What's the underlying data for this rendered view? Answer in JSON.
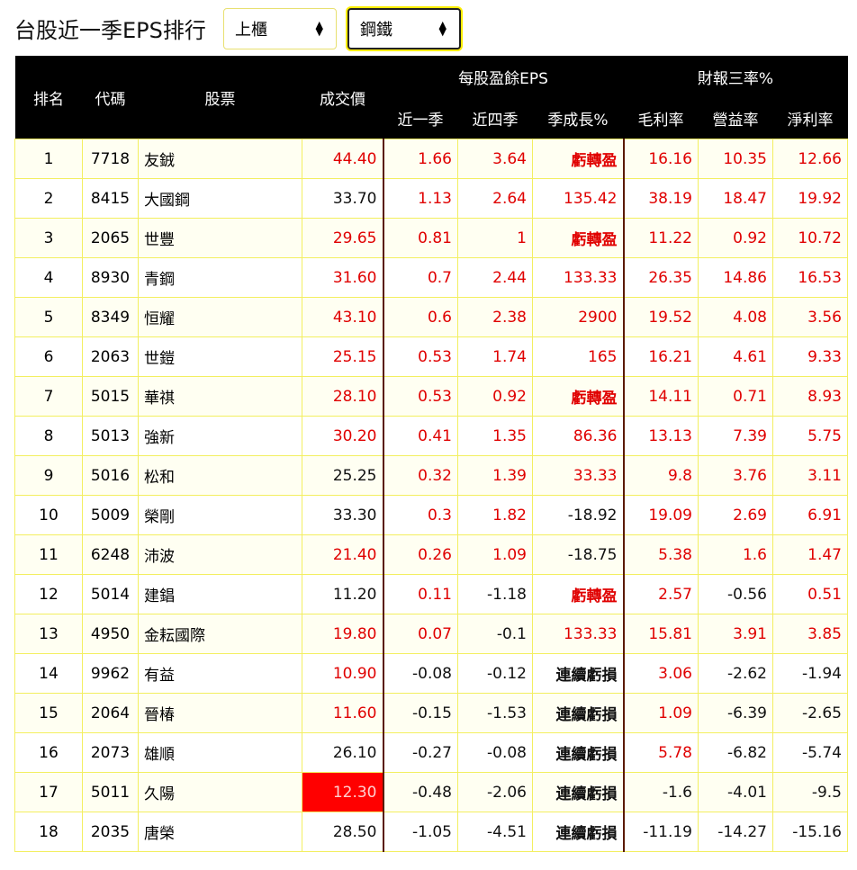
{
  "title": "台股近一季EPS排行",
  "market_select": {
    "value": "上櫃"
  },
  "industry_select": {
    "value": "鋼鐵"
  },
  "headers": {
    "rank": "排名",
    "code": "代碼",
    "stock": "股票",
    "price": "成交價",
    "eps_group": "每股盈餘EPS",
    "ratio_group": "財報三率%",
    "eps_q": "近一季",
    "eps_4q": "近四季",
    "growth": "季成長%",
    "gross": "毛利率",
    "operating": "營益率",
    "net": "淨利率"
  },
  "colors": {
    "up": "#e00000",
    "down": "#111111",
    "header_bg": "#000000",
    "grid": "#f3ef60"
  },
  "rows": [
    [
      "1",
      "7718",
      "友銊",
      "44.40",
      "r",
      "1.66",
      "3.64",
      "虧轉盈",
      "16.16",
      "10.35",
      "12.66"
    ],
    [
      "2",
      "8415",
      "大國鋼",
      "33.70",
      "k",
      "1.13",
      "2.64",
      "135.42",
      "38.19",
      "18.47",
      "19.92"
    ],
    [
      "3",
      "2065",
      "世豐",
      "29.65",
      "r",
      "0.81",
      "1",
      "虧轉盈",
      "11.22",
      "0.92",
      "10.72"
    ],
    [
      "4",
      "8930",
      "青鋼",
      "31.60",
      "r",
      "0.7",
      "2.44",
      "133.33",
      "26.35",
      "14.86",
      "16.53"
    ],
    [
      "5",
      "8349",
      "恒耀",
      "43.10",
      "r",
      "0.6",
      "2.38",
      "2900",
      "19.52",
      "4.08",
      "3.56"
    ],
    [
      "6",
      "2063",
      "世鎧",
      "25.15",
      "r",
      "0.53",
      "1.74",
      "165",
      "16.21",
      "4.61",
      "9.33"
    ],
    [
      "7",
      "5015",
      "華祺",
      "28.10",
      "r",
      "0.53",
      "0.92",
      "虧轉盈",
      "14.11",
      "0.71",
      "8.93"
    ],
    [
      "8",
      "5013",
      "強新",
      "30.20",
      "r",
      "0.41",
      "1.35",
      "86.36",
      "13.13",
      "7.39",
      "5.75"
    ],
    [
      "9",
      "5016",
      "松和",
      "25.25",
      "k",
      "0.32",
      "1.39",
      "33.33",
      "9.8",
      "3.76",
      "3.11"
    ],
    [
      "10",
      "5009",
      "榮剛",
      "33.30",
      "k",
      "0.3",
      "1.82",
      "-18.92",
      "19.09",
      "2.69",
      "6.91"
    ],
    [
      "11",
      "6248",
      "沛波",
      "21.40",
      "r",
      "0.26",
      "1.09",
      "-18.75",
      "5.38",
      "1.6",
      "1.47"
    ],
    [
      "12",
      "5014",
      "建錩",
      "11.20",
      "k",
      "0.11",
      "-1.18",
      "虧轉盈",
      "2.57",
      "-0.56",
      "0.51"
    ],
    [
      "13",
      "4950",
      "金耘國際",
      "19.80",
      "r",
      "0.07",
      "-0.1",
      "133.33",
      "15.81",
      "3.91",
      "3.85"
    ],
    [
      "14",
      "9962",
      "有益",
      "10.90",
      "r",
      "-0.08",
      "-0.12",
      "連續虧損",
      "3.06",
      "-2.62",
      "-1.94"
    ],
    [
      "15",
      "2064",
      "晉椿",
      "11.60",
      "r",
      "-0.15",
      "-1.53",
      "連續虧損",
      "1.09",
      "-6.39",
      "-2.65"
    ],
    [
      "16",
      "2073",
      "雄順",
      "26.10",
      "k",
      "-0.27",
      "-0.08",
      "連續虧損",
      "5.78",
      "-6.82",
      "-5.74"
    ],
    [
      "17",
      "5011",
      "久陽",
      "12.30",
      "alert",
      "-0.48",
      "-2.06",
      "連續虧損",
      "-1.6",
      "-4.01",
      "-9.5"
    ],
    [
      "18",
      "2035",
      "唐榮",
      "28.50",
      "k",
      "-1.05",
      "-4.51",
      "連續虧損",
      "-11.19",
      "-14.27",
      "-15.16"
    ]
  ]
}
